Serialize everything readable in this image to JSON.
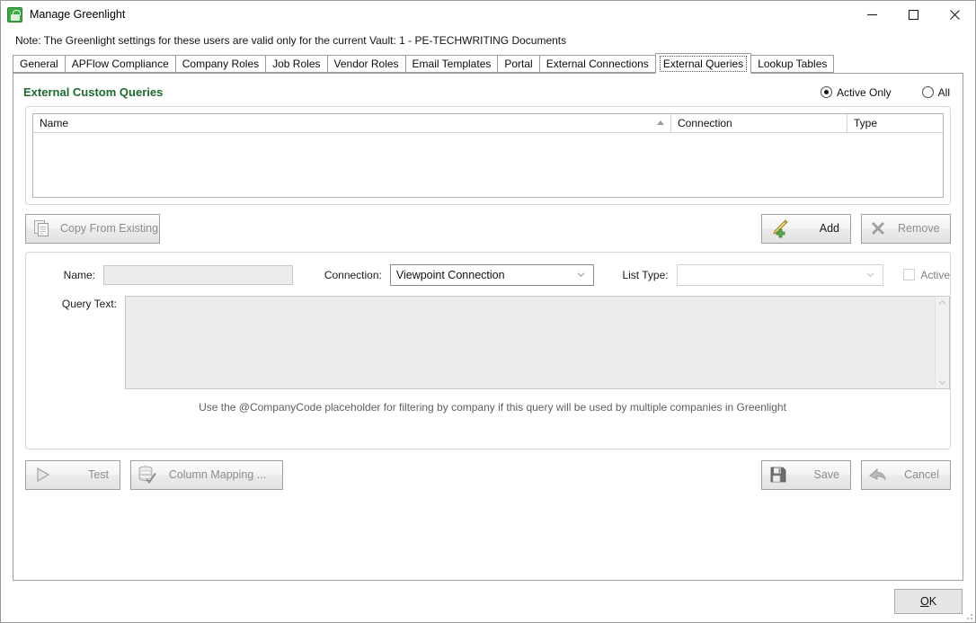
{
  "window": {
    "title": "Manage Greenlight",
    "icon": "greenlight-app-icon",
    "minimize_label": "Minimize",
    "maximize_label": "Maximize",
    "close_label": "Close"
  },
  "note": {
    "text": "Note:  The Greenlight settings for these users are valid only for the current Vault: 1 - PE-TECHWRITING Documents"
  },
  "tabs": [
    {
      "label": "General",
      "selected": false
    },
    {
      "label": "APFlow Compliance",
      "selected": false
    },
    {
      "label": "Company Roles",
      "selected": false
    },
    {
      "label": "Job Roles",
      "selected": false
    },
    {
      "label": "Vendor Roles",
      "selected": false
    },
    {
      "label": "Email Templates",
      "selected": false
    },
    {
      "label": "Portal",
      "selected": false
    },
    {
      "label": "External Connections",
      "selected": false
    },
    {
      "label": "External Queries",
      "selected": true
    },
    {
      "label": "Lookup Tables",
      "selected": false
    }
  ],
  "panel": {
    "title": "External Custom Queries",
    "title_color": "#1f6b2f",
    "filter": {
      "active_only_label": "Active Only",
      "all_label": "All",
      "selected": "Active Only"
    }
  },
  "grid": {
    "columns": [
      {
        "label": "Name",
        "sort": "ascending"
      },
      {
        "label": "Connection",
        "sort": ""
      },
      {
        "label": "Type",
        "sort": ""
      }
    ],
    "rows": []
  },
  "actions": {
    "copy_from_existing": {
      "label": "Copy From Existing",
      "icon": "copy-documents-icon",
      "enabled": false
    },
    "add": {
      "label": "Add",
      "icon": "pen-plus-icon",
      "enabled": true
    },
    "remove": {
      "label": "Remove",
      "icon": "x-mark-icon",
      "enabled": false
    }
  },
  "form": {
    "name_label": "Name:",
    "name_value": "",
    "connection_label": "Connection:",
    "connection_value": "Viewpoint Connection",
    "list_type_label": "List Type:",
    "list_type_value": "",
    "active_label": "Active",
    "active_checked": false,
    "query_text_label": "Query Text:",
    "query_text_value": "",
    "hint": "Use the @CompanyCode placeholder for filtering by company if this query will be used by multiple companies in Greenlight"
  },
  "bottom": {
    "test": {
      "label": "Test",
      "icon": "play-triangle-icon",
      "enabled": false
    },
    "column_mapping": {
      "label": "Column Mapping ...",
      "icon": "database-check-icon",
      "enabled": false
    },
    "save": {
      "label": "Save",
      "icon": "floppy-disk-icon",
      "enabled": false
    },
    "cancel": {
      "label": "Cancel",
      "icon": "back-arrow-icon",
      "enabled": false
    }
  },
  "footer": {
    "ok_accel": "O",
    "ok_rest": "K"
  }
}
